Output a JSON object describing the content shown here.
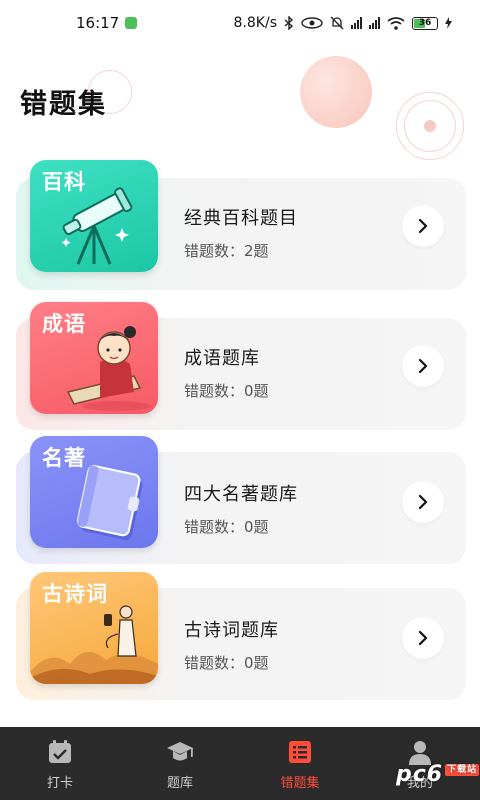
{
  "status_bar": {
    "time": "16:17",
    "net_speed": "8.8K/s",
    "battery": "36"
  },
  "header": {
    "title": "错题集"
  },
  "cards": [
    {
      "thumb_label": "百科",
      "title": "经典百科题目",
      "count": "错题数：2题",
      "accent": "#1cc7a5"
    },
    {
      "thumb_label": "成语",
      "title": "成语题库",
      "count": "错题数：0题",
      "accent": "#f75a64"
    },
    {
      "thumb_label": "名著",
      "title": "四大名著题库",
      "count": "错题数：0题",
      "accent": "#6d77ee"
    },
    {
      "thumb_label": "古诗词",
      "title": "古诗词题库",
      "count": "错题数：0题",
      "accent": "#f7a83a"
    }
  ],
  "bottom_nav": {
    "items": [
      {
        "label": "打卡",
        "icon": "calendar-check-icon"
      },
      {
        "label": "题库",
        "icon": "graduation-cap-icon"
      },
      {
        "label": "错题集",
        "icon": "list-icon",
        "active": true
      },
      {
        "label": "我的",
        "icon": "user-icon"
      }
    ],
    "active_color": "#ff4d3a"
  },
  "watermark": {
    "brand": "pc6",
    "tag": "下载站"
  }
}
